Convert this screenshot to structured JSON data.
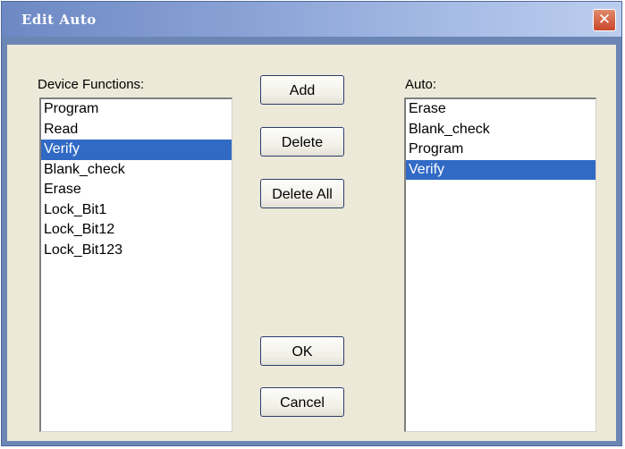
{
  "window": {
    "title": "Edit Auto",
    "close_glyph": "✕"
  },
  "device_functions": {
    "label": "Device Functions:",
    "items": [
      {
        "label": "Program",
        "selected": false
      },
      {
        "label": "Read",
        "selected": false
      },
      {
        "label": "Verify",
        "selected": true
      },
      {
        "label": "Blank_check",
        "selected": false
      },
      {
        "label": "Erase",
        "selected": false
      },
      {
        "label": "Lock_Bit1",
        "selected": false
      },
      {
        "label": "Lock_Bit12",
        "selected": false
      },
      {
        "label": "Lock_Bit123",
        "selected": false
      }
    ]
  },
  "auto": {
    "label": "Auto:",
    "items": [
      {
        "label": "Erase",
        "selected": false
      },
      {
        "label": "Blank_check",
        "selected": false
      },
      {
        "label": "Program",
        "selected": false
      },
      {
        "label": "Verify",
        "selected": true
      }
    ]
  },
  "buttons": {
    "add": "Add",
    "delete": "Delete",
    "delete_all": "Delete All",
    "ok": "OK",
    "cancel": "Cancel"
  },
  "colors": {
    "selection": "#316ac5",
    "dialog_face": "#ece9d8",
    "title_bar": "#6d88c4"
  }
}
